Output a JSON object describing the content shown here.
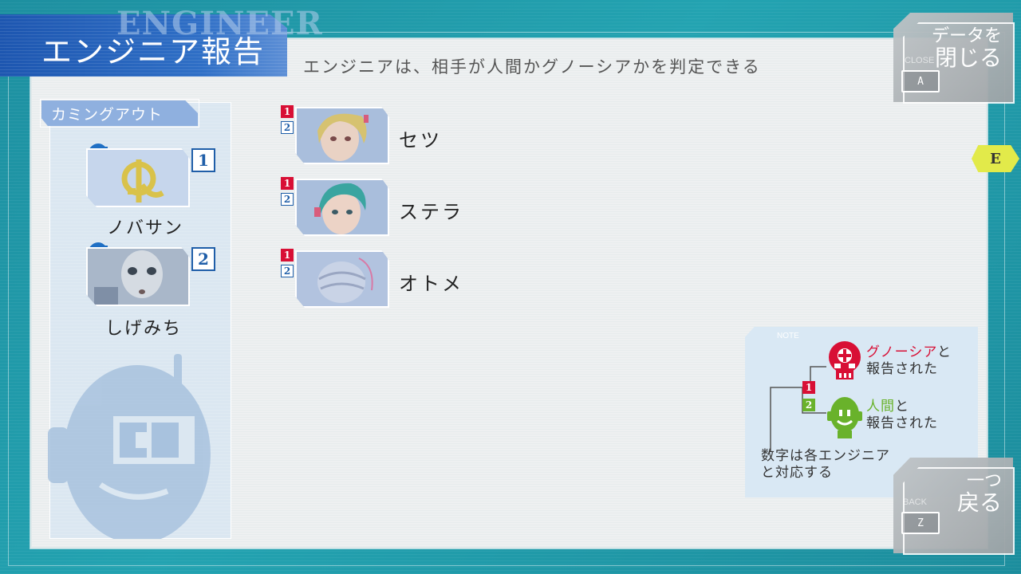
{
  "header": {
    "title_bg": "ENGINEER",
    "title": "エンジニア報告",
    "subtitle": "エンジニアは、相手が人間かグノーシアかを判定できる"
  },
  "close_button": {
    "small": "CLOSE",
    "line1": "データを",
    "line2": "閉じる",
    "key": "A"
  },
  "back_button": {
    "small": "BACK",
    "line1": "一つ",
    "line2": "戻る",
    "key": "Z"
  },
  "e_tab": "E",
  "coming_out": {
    "label": "カミングアウト",
    "engineers": [
      {
        "name": "ノバサン",
        "number": "1"
      },
      {
        "name": "しげみち",
        "number": "2"
      }
    ]
  },
  "reports": [
    {
      "name": "セツ",
      "marks": [
        "1",
        "2"
      ]
    },
    {
      "name": "ステラ",
      "marks": [
        "1",
        "2"
      ]
    },
    {
      "name": "オトメ",
      "marks": [
        "1",
        "2"
      ]
    }
  ],
  "note": {
    "label": "NOTE",
    "gnosia_word": "グノーシア",
    "gnosia_suffix": "と",
    "gnosia_line2": "報告された",
    "human_word": "人間",
    "human_suffix": "と",
    "human_line2": "報告された",
    "mark1": "1",
    "mark2": "2",
    "footer_line1": "数字は各エンジニア",
    "footer_line2": "と対応する"
  },
  "colors": {
    "gnosia": "#d80f35",
    "human": "#69b22b",
    "engineer": "#1f5ea8"
  }
}
